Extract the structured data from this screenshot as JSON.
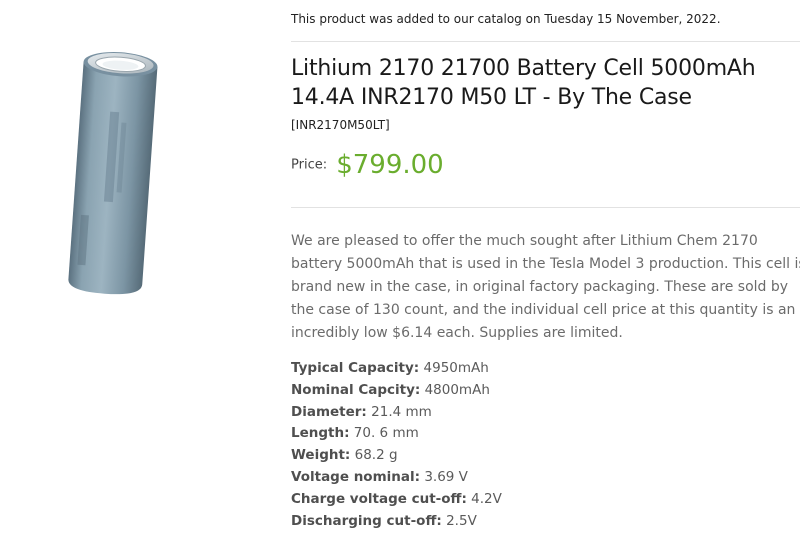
{
  "catalog_note": "This product was added to our catalog on Tuesday 15 November, 2022.",
  "product": {
    "title": "Lithium 2170 21700 Battery Cell 5000mAh 14.4A INR2170 M50 LT - By The Case",
    "model": "[INR2170M50LT]",
    "price_label": "Price:",
    "price": "$799.00",
    "description": "We are pleased to offer the much sought after Lithium Chem 2170 battery 5000mAh that is used in the Tesla Model 3 production. This cell is brand new in the case, in original factory packaging. These are sold by the case of 130 count, and the individual cell price at this quantity is an incredibly low $6.14 each. Supplies are limited.",
    "specs": [
      {
        "label": "Typical Capacity:",
        "value": "4950mAh"
      },
      {
        "label": "Nominal Capcity:",
        "value": "4800mAh"
      },
      {
        "label": "Diameter:",
        "value": "21.4 mm"
      },
      {
        "label": "Length:",
        "value": "70. 6 mm"
      },
      {
        "label": "Weight:",
        "value": "68.2 g"
      },
      {
        "label": "Voltage nominal:",
        "value": "3.69 V"
      },
      {
        "label": "Charge voltage cut-off:",
        "value": "4.2V"
      },
      {
        "label": "Discharging cut-off:",
        "value": "2.5V"
      }
    ]
  },
  "colors": {
    "price": "#6aad2e",
    "battery_body": "#7d97a6"
  }
}
